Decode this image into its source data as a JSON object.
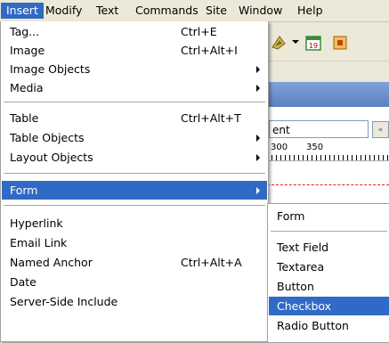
{
  "menubar": {
    "items": [
      "Insert",
      "Modify",
      "Text",
      "Commands",
      "Site",
      "Window",
      "Help"
    ]
  },
  "insert_menu": {
    "groups": [
      [
        {
          "label": "Tag...",
          "shortcut": "Ctrl+E"
        },
        {
          "label": "Image",
          "shortcut": "Ctrl+Alt+I"
        },
        {
          "label": "Image Objects"
        },
        {
          "label": "Media"
        }
      ],
      [
        {
          "label": "Table",
          "shortcut": "Ctrl+Alt+T"
        },
        {
          "label": "Table Objects"
        },
        {
          "label": "Layout Objects"
        }
      ],
      [
        {
          "label": "Form"
        }
      ],
      [
        {
          "label": "Hyperlink"
        },
        {
          "label": "Email Link"
        },
        {
          "label": "Named Anchor",
          "shortcut": "Ctrl+Alt+A"
        },
        {
          "label": "Date"
        },
        {
          "label": "Server-Side Include"
        }
      ]
    ]
  },
  "form_submenu": {
    "groups": [
      [
        {
          "label": "Form"
        }
      ],
      [
        {
          "label": "Text Field"
        },
        {
          "label": "Textarea"
        },
        {
          "label": "Button"
        },
        {
          "label": "Checkbox"
        },
        {
          "label": "Radio Button"
        }
      ]
    ]
  },
  "document": {
    "title_field_value": "ent",
    "ruler_labels": [
      "300",
      "350"
    ],
    "scroll_button_glyph": "«"
  },
  "colors": {
    "highlight": "#316ac5",
    "menu_background": "#ffffff",
    "chrome": "#ece9d8"
  }
}
